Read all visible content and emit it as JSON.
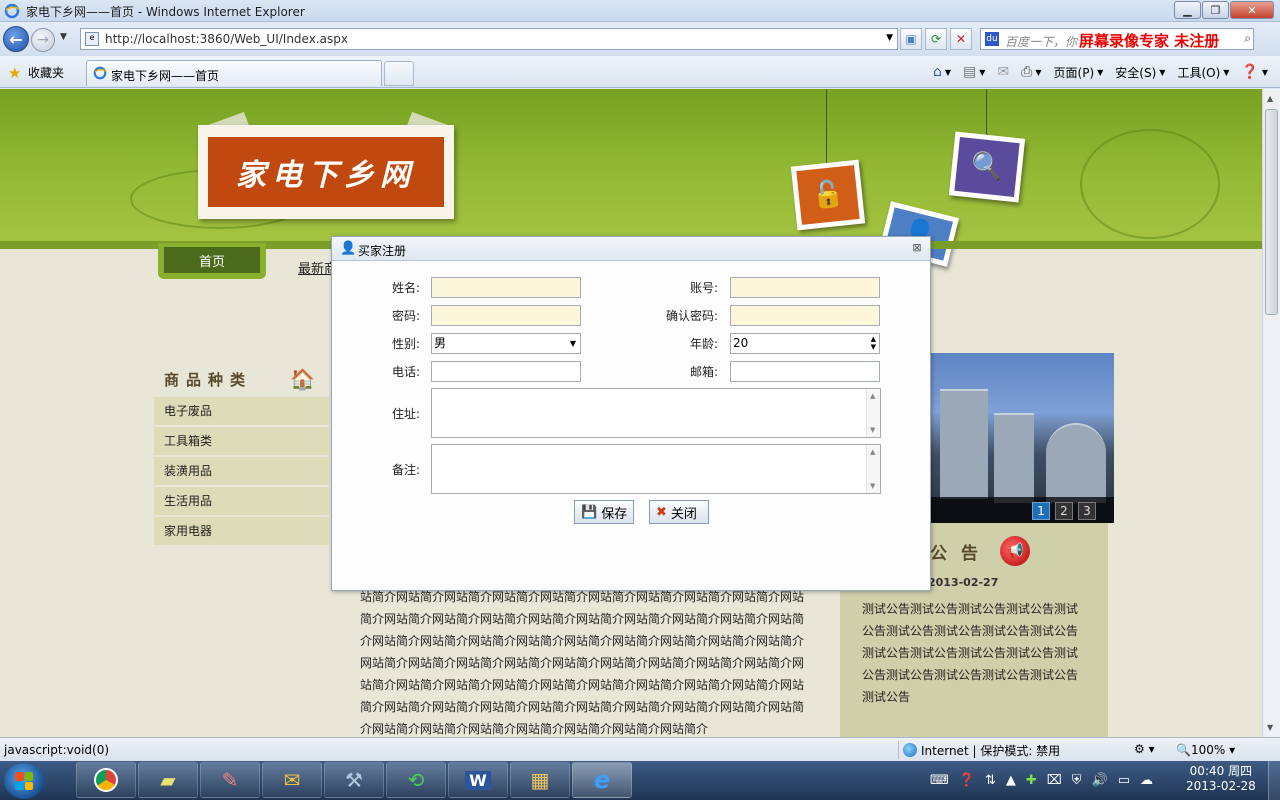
{
  "window": {
    "title": "家电下乡网——首页 - Windows Internet Explorer",
    "url": "http://localhost:3860/Web_UI/Index.aspx",
    "search_placeholder": "百度一下，你",
    "watermark": "屏幕录像专家 未注册"
  },
  "favbar": {
    "favorites": "收藏夹",
    "tab_title": "家电下乡网——首页",
    "commands": {
      "page": "页面(P)",
      "safety": "安全(S)",
      "tools": "工具(O)"
    }
  },
  "site": {
    "logo_text": "家电下乡网",
    "nav": {
      "home": "首页",
      "second": "最新商"
    },
    "category_title": "商品种类",
    "categories": [
      "电子废品",
      "工具箱类",
      "装潢用品",
      "生活用品",
      "家用电器"
    ],
    "slider_pages": [
      "1",
      "2",
      "3"
    ],
    "notice_title": "公告",
    "notice_date": "2013-02-27",
    "notice_text": "测试公告测试公告测试公告测试公告测试公告测试公告测试公告测试公告测试公告测试公告测试公告测试公告测试公告测试公告测试公告测试公告测试公告测试公告测试公告",
    "intro_text": "站简介网站简介网站简介网站简介网站简介网站简介网站简介网站简介网站简介网站简介网站简介网站简介网站简介网站简介网站简介网站简介网站简介网站简介网站简介网站简介网站简介网站简介网站简介网站简介网站简介网站简介网站简介网站简介网站简介网站简介网站简介网站简介网站简介网站简介网站简介网站简介网站简介网站简介网站简介网站简介网站简介网站简介网站简介网站简介网站简介网站简介网站简介网站简介网站简介网站简介网站简介网站简介网站简介网站简介网站简介网站简介网站简介网站简介网站简介网站简介网站简介网站简介网站简介"
  },
  "dialog": {
    "title": "买家注册",
    "fields": {
      "name": "姓名:",
      "account": "账号:",
      "password": "密码:",
      "confirm_password": "确认密码:",
      "gender": "性别:",
      "age": "年龄:",
      "phone": "电话:",
      "email": "邮箱:",
      "address": "住址:",
      "remark": "备注:"
    },
    "values": {
      "gender": "男",
      "age": "20"
    },
    "buttons": {
      "save": "保存",
      "close": "关闭"
    }
  },
  "statusbar": {
    "status": "javascript:void(0)",
    "zone": "Internet | 保护模式: 禁用",
    "zoom": "100%"
  },
  "taskbar": {
    "time": "00:40 周四",
    "date": "2013-02-28"
  }
}
